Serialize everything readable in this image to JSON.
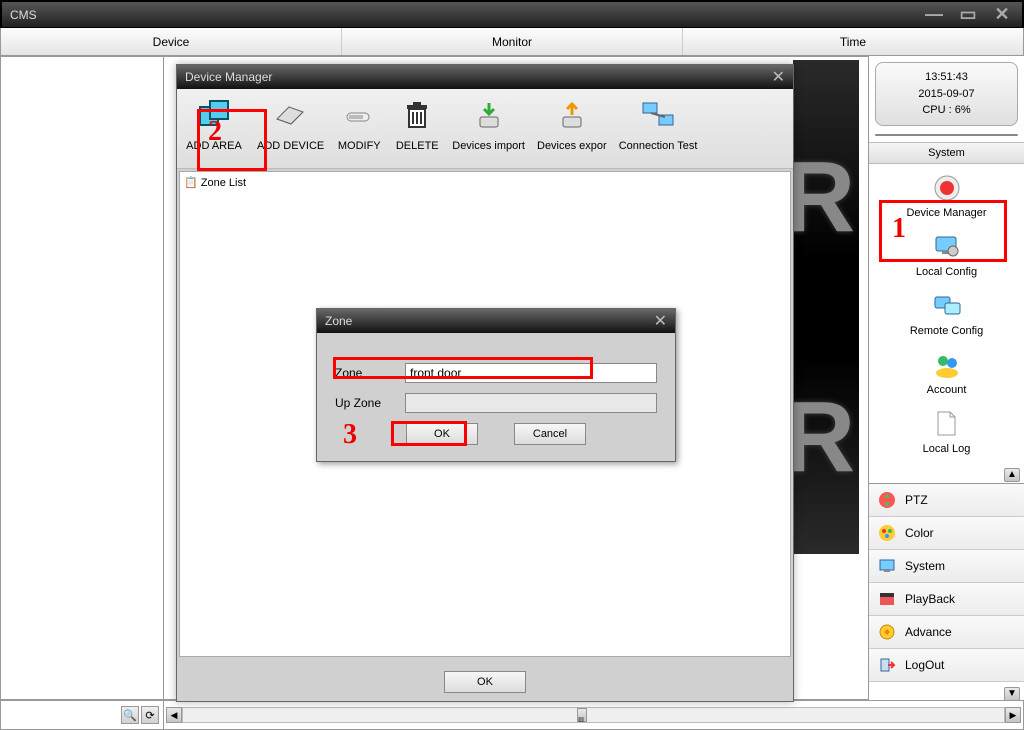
{
  "titlebar": {
    "app_name": "CMS"
  },
  "menubar": {
    "device": "Device",
    "monitor": "Monitor",
    "time": "Time"
  },
  "status": {
    "time": "13:51:43",
    "date": "2015-09-07",
    "cpu": "CPU : 6%"
  },
  "section": {
    "system": "System"
  },
  "system_items": {
    "device_manager": "Device Manager",
    "local_config": "Local Config",
    "remote_config": "Remote Config",
    "account": "Account",
    "local_log": "Local Log"
  },
  "bottom_list": {
    "ptz": "PTZ",
    "color": "Color",
    "system": "System",
    "playback": "PlayBack",
    "advance": "Advance",
    "logout": "LogOut"
  },
  "dm": {
    "title": "Device Manager",
    "toolbar": {
      "add_area": "ADD AREA",
      "add_device": "ADD DEVICE",
      "modify": "MODIFY",
      "delete": "DELETE",
      "devices_import": "Devices import",
      "devices_export": "Devices expor",
      "connection_test": "Connection Test"
    },
    "tree": {
      "zone_list": "Zone List"
    },
    "ok": "OK"
  },
  "zone": {
    "title": "Zone",
    "zone_label": "Zone",
    "up_zone_label": "Up Zone",
    "zone_value": "front door",
    "up_zone_value": "",
    "ok": "OK",
    "cancel": "Cancel"
  },
  "annotations": {
    "n1": "1",
    "n2": "2",
    "n3": "3"
  },
  "scrollbar_label": "III"
}
